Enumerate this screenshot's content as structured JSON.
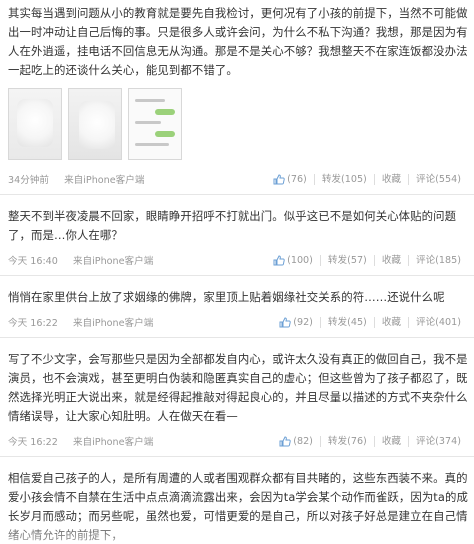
{
  "posts": [
    {
      "text": "其实每当遇到问题从小的教育就是要先自我检讨，更何况有了小孩的前提下，当然不可能做出一时冲动让自己后悔的事。只是很多人或许会问，为什么不私下沟通？我想，那是因为有人在外逍遥，挂电话不回信息无从沟通。那是不是关心不够？我想整天不在家连饭都没办法一起吃上的还谈什么关心，能见到都不错了。",
      "images": [
        "photo-1",
        "photo-2",
        "chat-screenshot"
      ],
      "time": "34分钟前",
      "source": "来自iPhone客户端",
      "likes": "(76)",
      "repost": "转发(105)",
      "fav": "收藏",
      "comment": "评论(554)"
    },
    {
      "text": "整天不到半夜凌晨不回家，眼睛睁开招呼不打就出门。似乎这已不是如何关心体贴的问题了，而是…你人在哪？",
      "time": "今天 16:40",
      "source": "来自iPhone客户端",
      "likes": "(100)",
      "repost": "转发(57)",
      "fav": "收藏",
      "comment": "评论(185)"
    },
    {
      "text": "悄悄在家里供台上放了求姻缘的佛牌，家里顶上贴着姻缘社交关系的符……还说什么呢",
      "time": "今天 16:22",
      "source": "来自iPhone客户端",
      "likes": "(92)",
      "repost": "转发(45)",
      "fav": "收藏",
      "comment": "评论(401)"
    },
    {
      "text": "写了不少文字，会写那些只是因为全部都发自内心，或许太久没有真正的做回自己，我不是演员，也不会演戏，甚至更明白伪装和隐匿真实自己的虚心；但这些曾为了孩子都忍了，既然选择光明正大说出来，就是经得起推敲对得起良心的，并且尽量以描述的方式不夹杂什么情绪误导，让大家心知肚明。人在做天在看—",
      "time": "今天 16:22",
      "source": "来自iPhone客户端",
      "likes": "(82)",
      "repost": "转发(76)",
      "fav": "收藏",
      "comment": "评论(374)"
    },
    {
      "text": "相信爱自己孩子的人，是所有周遭的人或者围观群众都有目共睹的，这些东西装不来。真的爱小孩会情不自禁在生活中点点滴滴流露出来，会因为ta学会某个动作而雀跃，因为ta的成长岁月而感动；而另些呢，虽然也爱，可惜更爱的是自己，所以对孩子好总是建立在自己情绪心情允许的前提下，"
    }
  ],
  "colors": {
    "text": "#333333",
    "meta": "#999999",
    "divider": "#e6e6e6"
  }
}
